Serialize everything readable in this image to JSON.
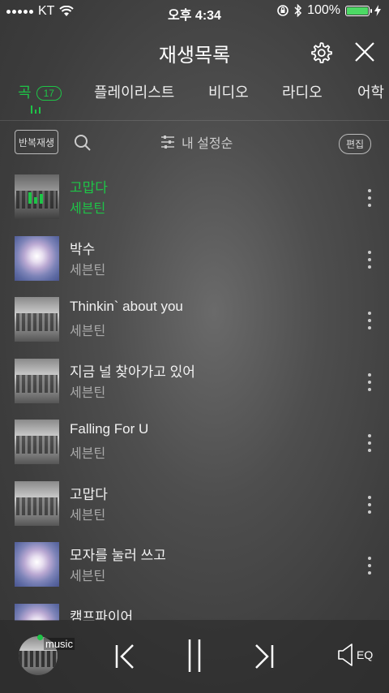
{
  "status_bar": {
    "carrier": "KT",
    "time": "오후 4:34",
    "battery": "100%",
    "battery_level": 1.0
  },
  "header": {
    "title": "재생목록"
  },
  "tabs": [
    {
      "label": "곡",
      "count": "17",
      "active": true
    },
    {
      "label": "플레이리스트"
    },
    {
      "label": "비디오"
    },
    {
      "label": "라디오"
    },
    {
      "label": "어학"
    }
  ],
  "toolbar": {
    "repeat_label": "반복재생",
    "sort_label": "내 설정순",
    "edit_label": "편집"
  },
  "songs": [
    {
      "title": "고맙다",
      "artist": "세븐틴",
      "art": "plot",
      "current": true
    },
    {
      "title": "박수",
      "artist": "세븐틴",
      "art": "burst"
    },
    {
      "title": "Thinkin` about you",
      "artist": "세븐틴",
      "art": "plot"
    },
    {
      "title": "지금 널 찾아가고 있어",
      "artist": "세븐틴",
      "art": "plot"
    },
    {
      "title": "Falling For U",
      "artist": "세븐틴",
      "art": "plot"
    },
    {
      "title": "고맙다",
      "artist": "세븐틴",
      "art": "plot"
    },
    {
      "title": "모자를 눌러 쓰고",
      "artist": "세븐틴",
      "art": "burst"
    },
    {
      "title": "캠프파이어",
      "artist": "",
      "art": "burst"
    }
  ],
  "player": {
    "label": "music",
    "eq_label": "EQ"
  },
  "colors": {
    "accent": "#1ec447"
  }
}
